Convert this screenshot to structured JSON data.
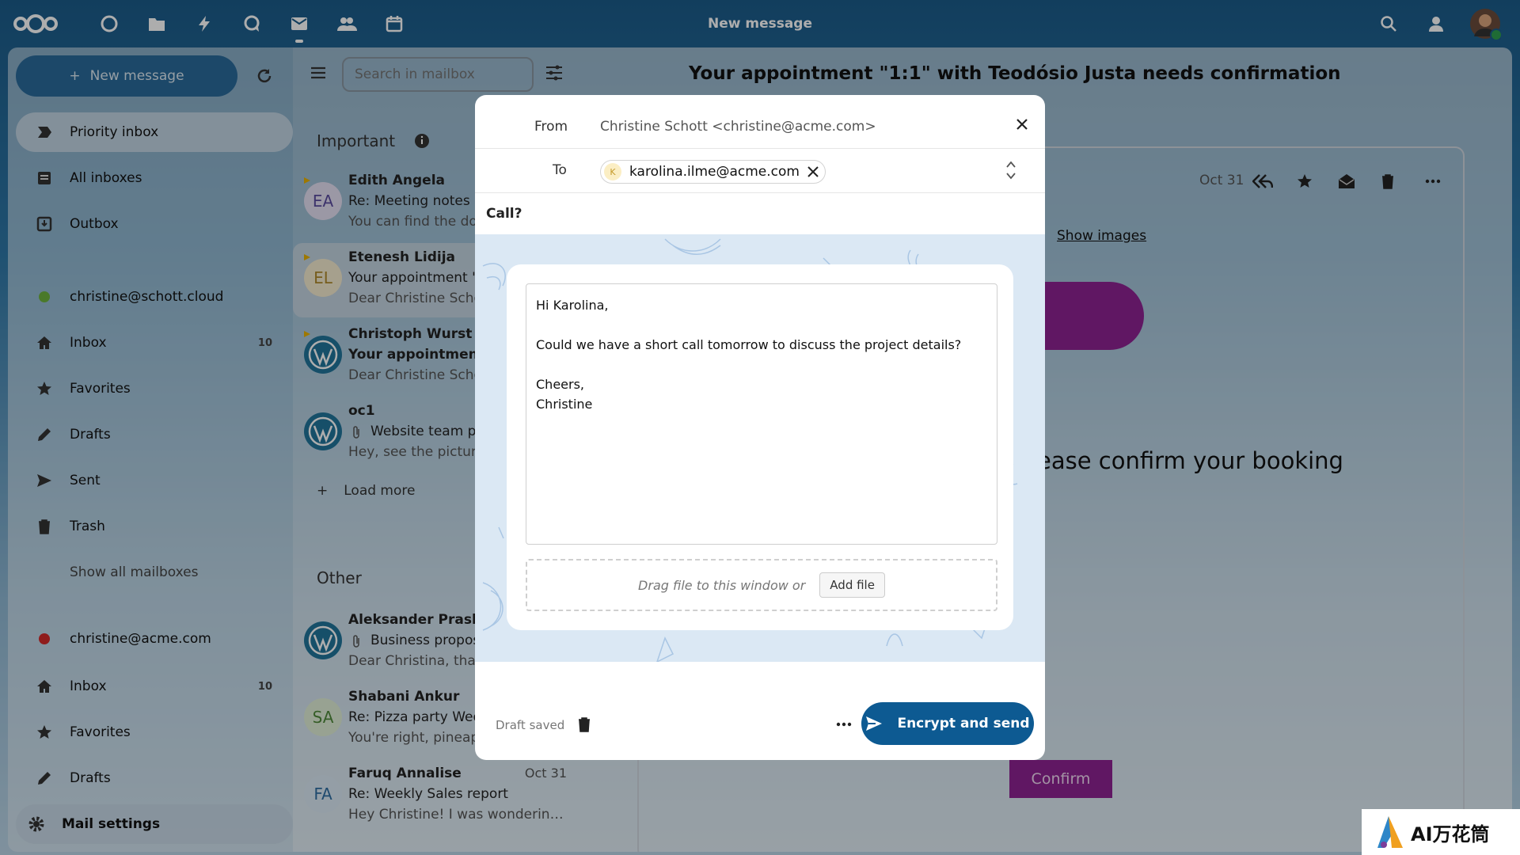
{
  "topbar": {
    "title": "New message",
    "apps": [
      "dashboard-icon",
      "files-icon",
      "activity-icon",
      "talk-icon",
      "mail-icon",
      "contacts-icon",
      "calendar-icon"
    ]
  },
  "sidebar": {
    "new_message": "New message",
    "items": [
      {
        "label": "Priority inbox"
      },
      {
        "label": "All inboxes"
      },
      {
        "label": "Outbox"
      }
    ],
    "account1": {
      "email": "christine@schott.cloud",
      "color": "#6db33f",
      "inbox": "Inbox",
      "inbox_count": "10",
      "favorites": "Favorites",
      "drafts": "Drafts",
      "sent": "Sent",
      "trash": "Trash",
      "show_all": "Show all mailboxes"
    },
    "account2": {
      "email": "christine@acme.com",
      "color": "#d32a2a",
      "inbox": "Inbox",
      "inbox_count": "10",
      "favorites": "Favorites",
      "drafts": "Drafts"
    },
    "settings": "Mail settings"
  },
  "list": {
    "search_placeholder": "Search in mailbox",
    "important_label": "Important",
    "other_label": "Other",
    "load_more": "Load more",
    "important": [
      {
        "initials": "EA",
        "from": "Edith Angela",
        "subject": "Re: Meeting notes",
        "preview": "You can find the doc"
      },
      {
        "initials": "EL",
        "from": "Etenesh Lidija",
        "subject": "Your appointment \"",
        "preview": "Dear Christine Scho"
      },
      {
        "initials": "",
        "from": "Christoph Wurst",
        "subject": "Your appointment '",
        "preview": "Dear Christine Scho"
      },
      {
        "initials": "",
        "from": "oc1",
        "subject": "Website team ph",
        "preview": "Hey, see the picture"
      }
    ],
    "other": [
      {
        "initials": "",
        "from": "Aleksander Praskov",
        "subject": "Business propos",
        "preview": "Dear Christina, than",
        "date": ""
      },
      {
        "initials": "SA",
        "from": "Shabani Ankur",
        "subject": "Re: Pizza party Wed",
        "preview": "You're right, pineapp",
        "date": ""
      },
      {
        "initials": "FA",
        "from": "Faruq Annalise",
        "subject": "Re: Weekly Sales report",
        "preview": "Hey Christine! I was wonderin…",
        "date": "Oct 31"
      }
    ]
  },
  "reader": {
    "title": "Your appointment \"1:1\" with Teodósio Justa needs confirmation",
    "date": "Oct 31",
    "show_images": "Show images",
    "booking_text": "ease confirm your booking",
    "confirm": "Confirm"
  },
  "composer": {
    "from_label": "From",
    "from_value": "Christine Schott <christine@acme.com>",
    "to_label": "To",
    "to_initial": "K",
    "to_value": "karolina.ilme@acme.com",
    "subject": "Call?",
    "body": [
      "Hi Karolina,",
      "",
      "Could we have a short call tomorrow to discuss the project details?",
      "",
      "Cheers,",
      "Christine"
    ],
    "drop_text": "Drag file to this window or",
    "add_file": "Add file",
    "draft_status": "Draft saved",
    "send": "Encrypt and send"
  },
  "watermark": "AI万花筒"
}
